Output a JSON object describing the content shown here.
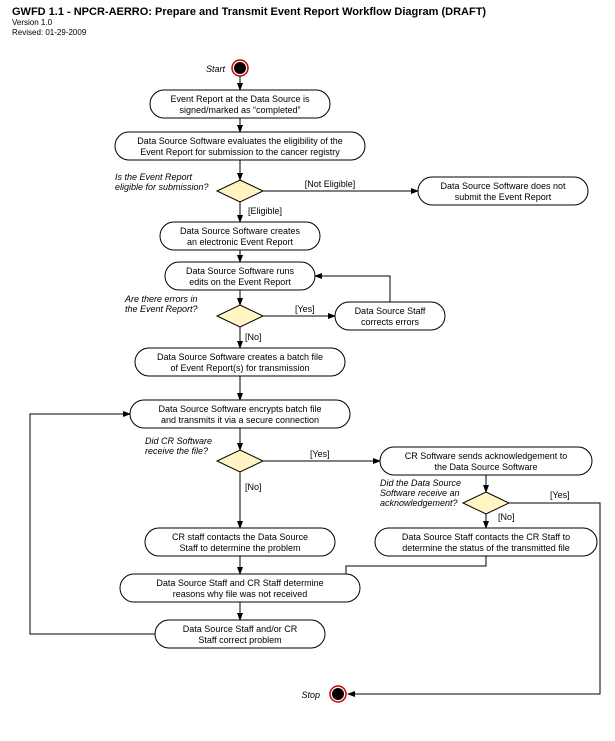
{
  "header": {
    "doc_id": "GWFD 1.1",
    "title": "NPCR-AERRO:  Prepare and Transmit Event Report Workflow Diagram (DRAFT)",
    "version": "1.0",
    "revised": "01-29-2009"
  },
  "labels": {
    "start": "Start",
    "stop": "Stop",
    "eligible": "[Eligible]",
    "not_eligible": "[Not Eligible]",
    "yes": "[Yes]",
    "no": "[No]"
  },
  "questions": {
    "q_elig": [
      "Is the Event Report",
      "eligible for submission?"
    ],
    "q_err": [
      "Are there errors in",
      "the Event Report?"
    ],
    "q_recv": [
      "Did CR Software",
      "receive the file?"
    ],
    "q_ack": [
      "Did the Data Source",
      "Software receive an",
      "acknowledgement?"
    ]
  },
  "nodes": {
    "n1": [
      "Event Report at the Data Source is",
      "signed/marked as “completed”"
    ],
    "n2": [
      "Data Source Software evaluates the eligibility of the",
      "Event Report for submission to the cancer registry"
    ],
    "n3": [
      "Data Source Software does not",
      "submit the Event Report"
    ],
    "n4": [
      "Data Source Software creates",
      "an electronic Event Report"
    ],
    "n5": [
      "Data Source Software runs",
      "edits on the Event Report"
    ],
    "n6": [
      "Data Source Staff",
      "corrects errors"
    ],
    "n7": [
      "Data Source Software creates a batch file",
      "of Event Report(s) for transmission"
    ],
    "n8": [
      "Data Source Software encrypts batch file",
      "and transmits it via a secure connection"
    ],
    "n9": [
      "CR Software sends acknowledgement to",
      "the Data Source Software"
    ],
    "n10": [
      "CR staff contacts the Data Source",
      "Staff to determine the problem"
    ],
    "n11": [
      "Data Source Staff contacts the CR Staff to",
      "determine the status of the transmitted file"
    ],
    "n12": [
      "Data Source Staff and CR Staff determine",
      "reasons why file was not received"
    ],
    "n13": [
      "Data Source Staff and/or CR",
      "Staff correct problem"
    ]
  }
}
